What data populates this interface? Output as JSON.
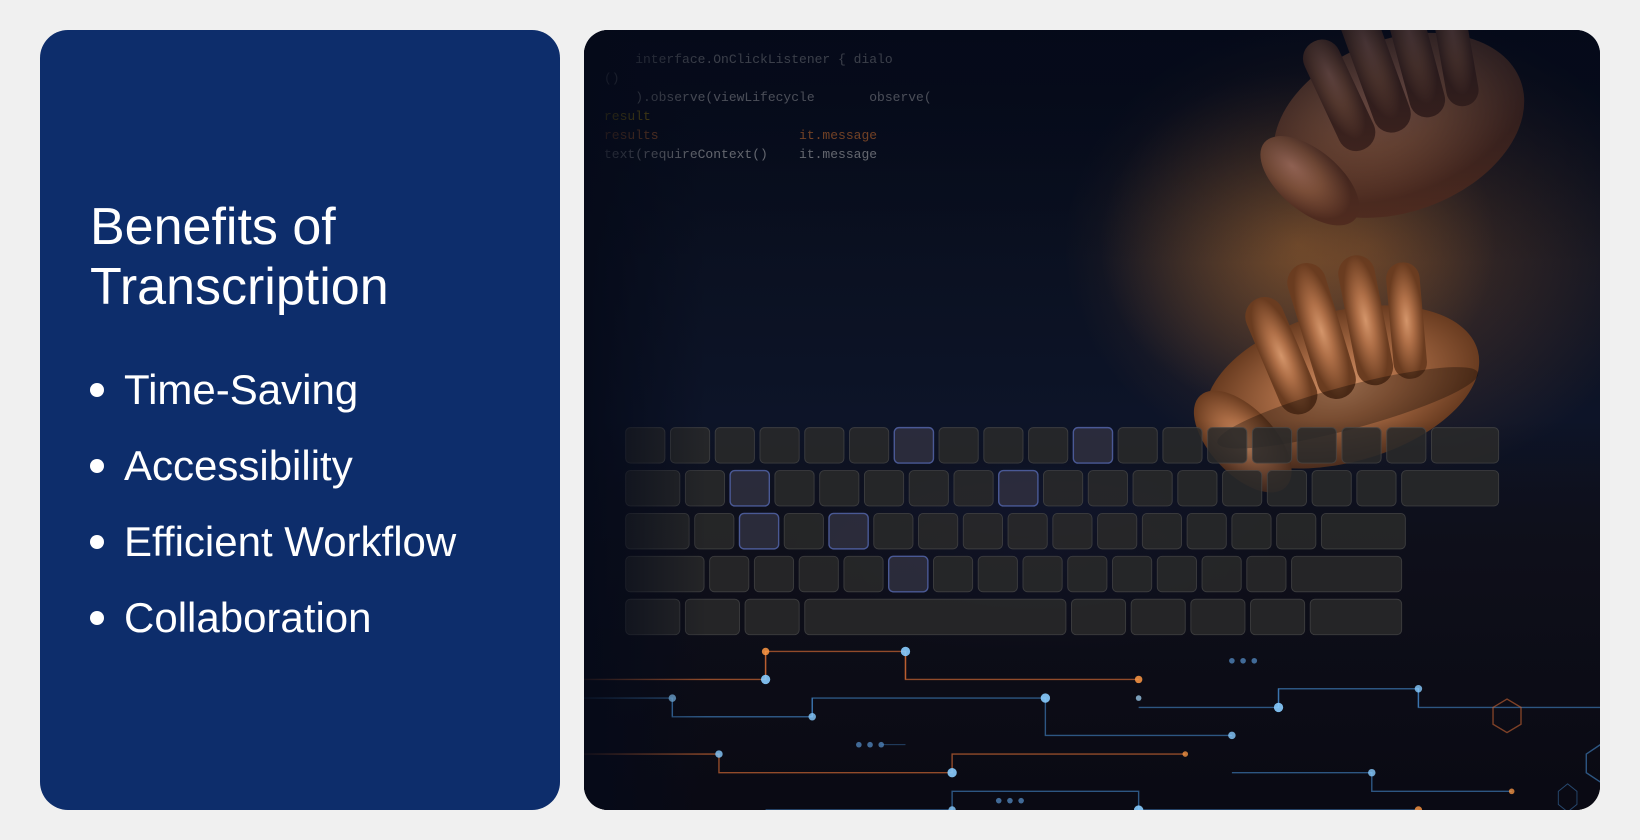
{
  "left": {
    "title_line1": "Benefits of",
    "title_line2": "Transcription",
    "bullet_items": [
      {
        "id": "time-saving",
        "label": "Time-Saving"
      },
      {
        "id": "accessibility",
        "label": "Accessibility"
      },
      {
        "id": "efficient-workflow",
        "label": "Efficient Workflow"
      },
      {
        "id": "collaboration",
        "label": "Collaboration"
      }
    ]
  },
  "right": {
    "alt_text": "Hands typing on a keyboard with code and circuit board overlay"
  },
  "colors": {
    "panel_bg": "#0d2d6b",
    "text_white": "#ffffff"
  }
}
